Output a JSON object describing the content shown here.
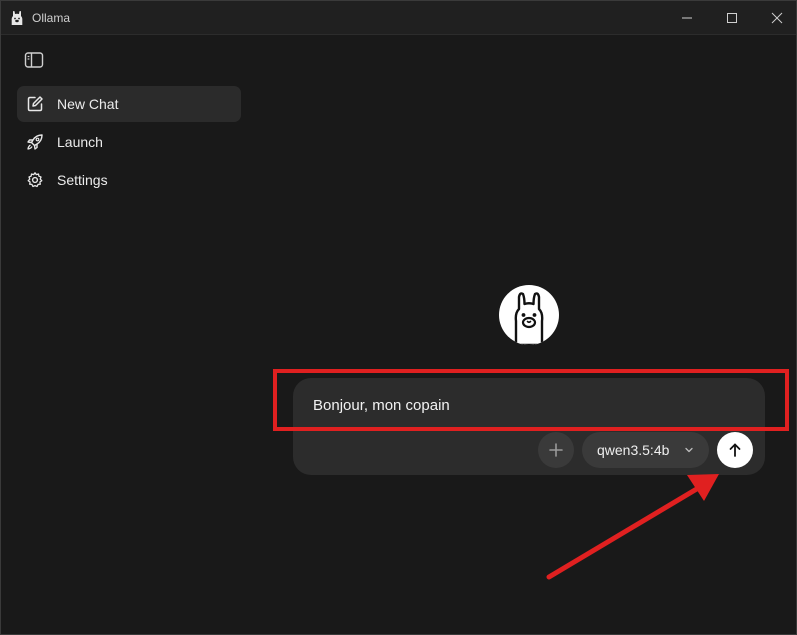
{
  "window": {
    "title": "Ollama"
  },
  "sidebar": {
    "items": [
      {
        "label": "New Chat",
        "icon": "edit-icon",
        "active": true
      },
      {
        "label": "Launch",
        "icon": "rocket-icon",
        "active": false
      },
      {
        "label": "Settings",
        "icon": "gear-icon",
        "active": false
      }
    ]
  },
  "composer": {
    "input_value": "Bonjour, mon copain",
    "model": "qwen3.5:4b",
    "attach_icon": "plus-icon",
    "send_icon": "arrow-up-icon"
  },
  "colors": {
    "background": "#191919",
    "sidebar_active": "#2b2b2b",
    "composer": "#2c2c2c",
    "annotation_red": "#e02020"
  }
}
